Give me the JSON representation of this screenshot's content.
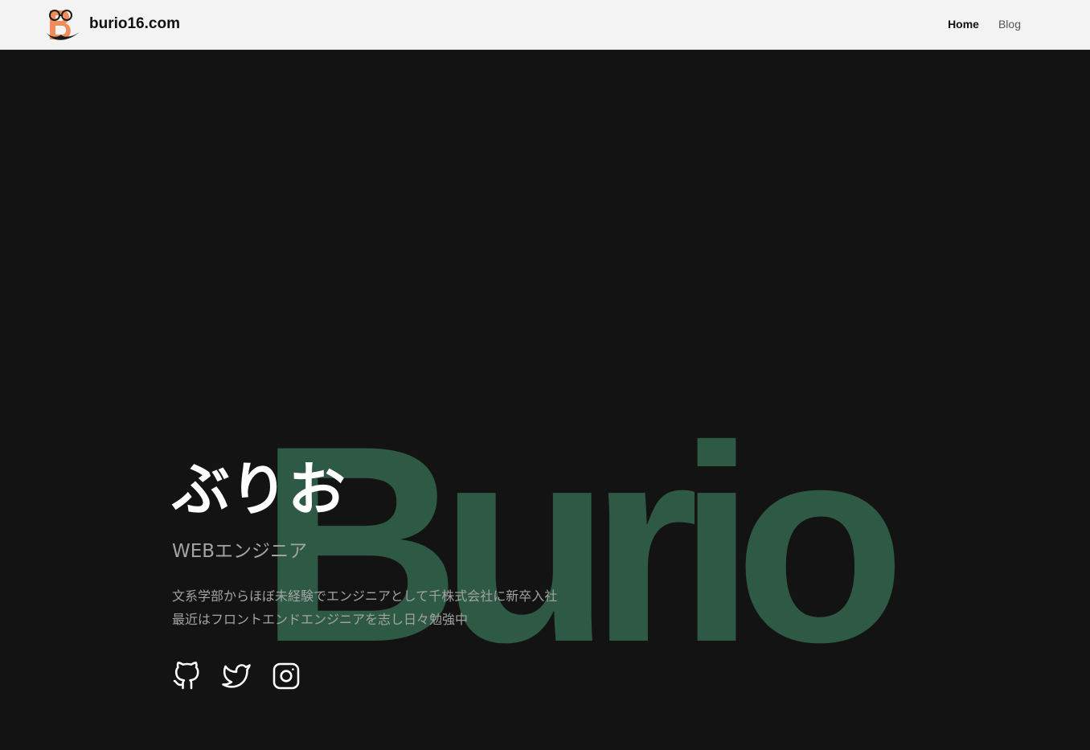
{
  "header": {
    "site_title": "burio16.com",
    "logo_icon": "burio-logo-icon",
    "nav": [
      {
        "label": "Home",
        "active": true
      },
      {
        "label": "Blog",
        "active": false
      }
    ]
  },
  "hero": {
    "background_word": "Burio",
    "name": "ぶりお",
    "role": "WEBエンジニア",
    "bio": [
      "文系学部からほぼ未経験でエンジニアとして千株式会社に新卒入社",
      "最近はフロントエンドエンジニアを志し日々勉強中"
    ],
    "social": [
      {
        "icon": "github-icon"
      },
      {
        "icon": "twitter-icon"
      },
      {
        "icon": "instagram-icon"
      }
    ]
  },
  "colors": {
    "header_bg": "#f3f3f3",
    "page_bg": "#131313",
    "accent_green": "#2e5a45",
    "logo_orange": "#ef8c57",
    "muted_text": "#a3a3a3"
  }
}
